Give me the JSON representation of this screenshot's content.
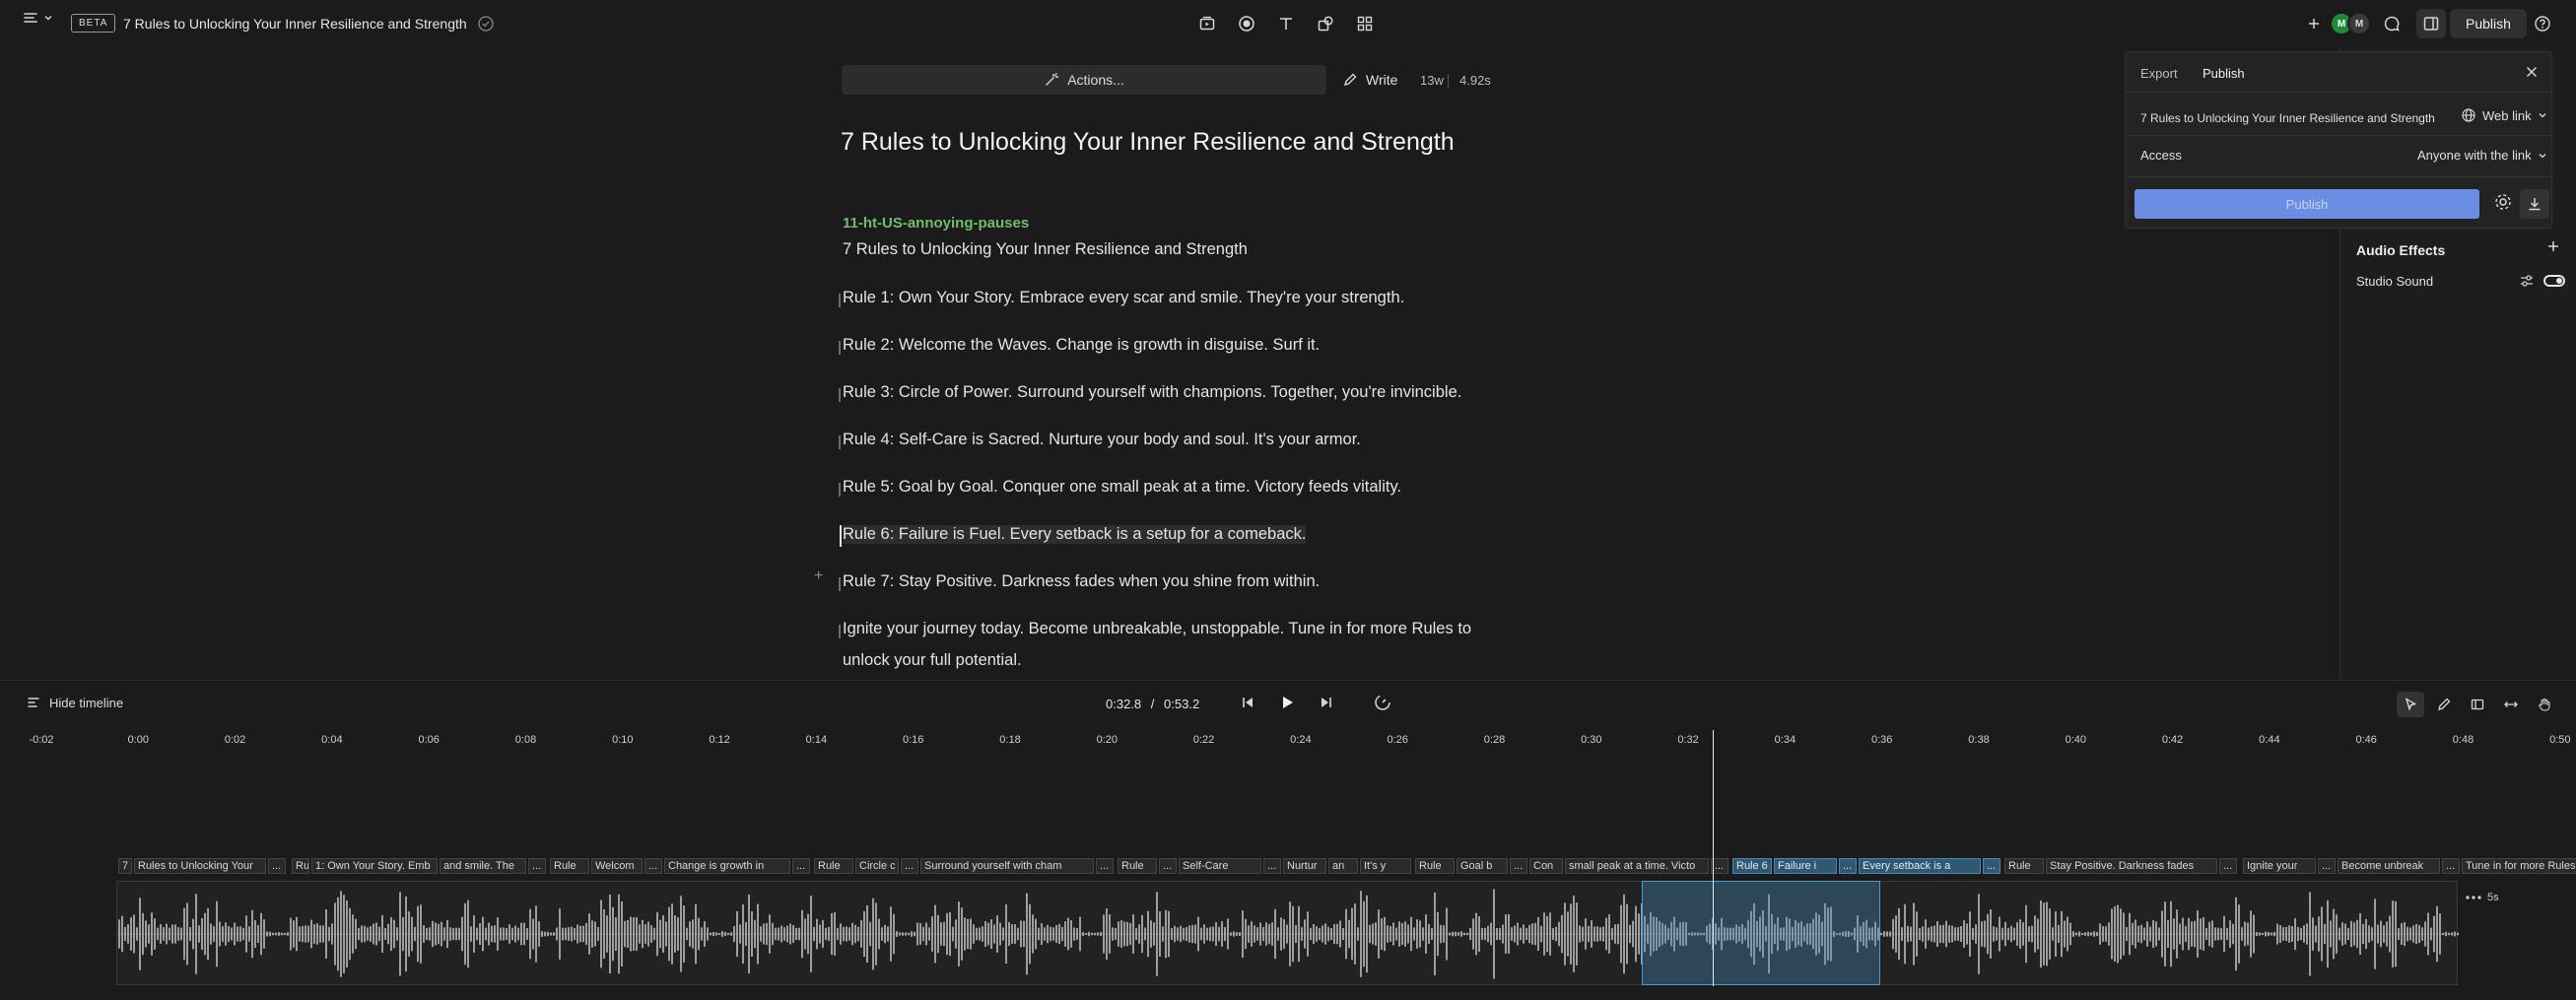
{
  "topbar": {
    "beta_label": "BETA",
    "doc_title": "7 Rules to Unlocking Your Inner Resilience and Strength",
    "avatars": [
      {
        "initials": "M",
        "color": "#1f8a3a"
      },
      {
        "initials": "M",
        "color": "#3a3a3a"
      }
    ],
    "publish_label": "Publish"
  },
  "editor": {
    "actions_label": "Actions...",
    "write_label": "Write",
    "word_count": "13w",
    "duration": "4.92s",
    "title": "7 Rules to Unlocking Your Inner Resilience and Strength",
    "speaker": "11-ht-US-annoying-pauses",
    "paragraphs": [
      "7 Rules to Unlocking Your Inner Resilience and Strength",
      "Rule 1: Own Your Story. Embrace every scar and smile. They're your strength.",
      "Rule 2: Welcome the Waves. Change is growth in disguise. Surf it.",
      "Rule 3: Circle of Power. Surround yourself with champions. Together, you're invincible.",
      "Rule 4: Self-Care is Sacred. Nurture your body and soul. It's your armor.",
      "Rule 5: Goal by Goal. Conquer one small peak at a time. Victory feeds vitality.",
      "Rule 6: Failure is Fuel. Every setback is a setup for a comeback.",
      "Rule 7: Stay Positive. Darkness fades when you shine from within.",
      "Ignite your journey today. Become unbreakable, unstoppable. Tune in for more Rules to",
      "unlock your full potential."
    ]
  },
  "publish_panel": {
    "tab_export": "Export",
    "tab_publish": "Publish",
    "doc_title": "7 Rules to Unlocking Your Inner Resilience and Strength",
    "link_type": "Web link",
    "access_label": "Access",
    "access_value": "Anyone with the link",
    "publish_button": "Publish"
  },
  "audio_effects": {
    "title": "Audio Effects",
    "studio_sound_label": "Studio Sound",
    "studio_sound_on": true
  },
  "timeline": {
    "hide_label": "Hide timeline",
    "current_time": "0:32.8",
    "separator": "/",
    "total_time": "0:53.2",
    "ticks": [
      "-0:02",
      "0:00",
      "0:02",
      "0:04",
      "0:06",
      "0:08",
      "0:10",
      "0:12",
      "0:14",
      "0:16",
      "0:18",
      "0:20",
      "0:22",
      "0:24",
      "0:26",
      "0:28",
      "0:30",
      "0:32",
      "0:34",
      "0:36",
      "0:38",
      "0:40",
      "0:42",
      "0:44",
      "0:46",
      "0:48",
      "0:50"
    ],
    "words": [
      {
        "t": "7",
        "s": false
      },
      {
        "t": "Rules to Unlocking Your",
        "s": false
      },
      {
        "t": "...",
        "s": false
      },
      {
        "t": "Ru",
        "s": false
      },
      {
        "t": "1: Own Your Story. Emb",
        "s": false
      },
      {
        "t": "and smile. The",
        "s": false
      },
      {
        "t": "...",
        "s": false
      },
      {
        "t": "Rule",
        "s": false
      },
      {
        "t": "Welcom",
        "s": false
      },
      {
        "t": "...",
        "s": false
      },
      {
        "t": "Change is growth in",
        "s": false
      },
      {
        "t": "...",
        "s": false
      },
      {
        "t": "Rule",
        "s": false
      },
      {
        "t": "Circle c",
        "s": false
      },
      {
        "t": "...",
        "s": false
      },
      {
        "t": "Surround yourself with cham",
        "s": false
      },
      {
        "t": "...",
        "s": false
      },
      {
        "t": "Rule",
        "s": false
      },
      {
        "t": "...",
        "s": false
      },
      {
        "t": "Self-Care",
        "s": false
      },
      {
        "t": "...",
        "s": false
      },
      {
        "t": "Nurtur",
        "s": false
      },
      {
        "t": "an",
        "s": false
      },
      {
        "t": "It's y",
        "s": false
      },
      {
        "t": "Rule",
        "s": false
      },
      {
        "t": "Goal b",
        "s": false
      },
      {
        "t": "...",
        "s": false
      },
      {
        "t": "Con",
        "s": false
      },
      {
        "t": "small peak at a time. Victo",
        "s": false
      },
      {
        "t": "...",
        "s": false
      },
      {
        "t": "Rule 6",
        "s": true
      },
      {
        "t": "Failure i",
        "s": true
      },
      {
        "t": "...",
        "s": true
      },
      {
        "t": "Every setback is a",
        "s": true
      },
      {
        "t": "...",
        "s": true
      },
      {
        "t": "Rule",
        "s": false
      },
      {
        "t": "Stay Positive. Darkness fades",
        "s": false
      },
      {
        "t": "...",
        "s": false
      },
      {
        "t": "Ignite your",
        "s": false
      },
      {
        "t": "...",
        "s": false
      },
      {
        "t": "Become unbreak",
        "s": false
      },
      {
        "t": "...",
        "s": false
      },
      {
        "t": "Tune in for more Rules to",
        "s": false
      }
    ],
    "more_label": "5s"
  },
  "icons": {
    "menu": "menu-icon",
    "check": "check-circle-icon",
    "toolbar": [
      "media-icon",
      "record-icon",
      "text-icon",
      "shapes-icon",
      "grid-icon"
    ]
  }
}
